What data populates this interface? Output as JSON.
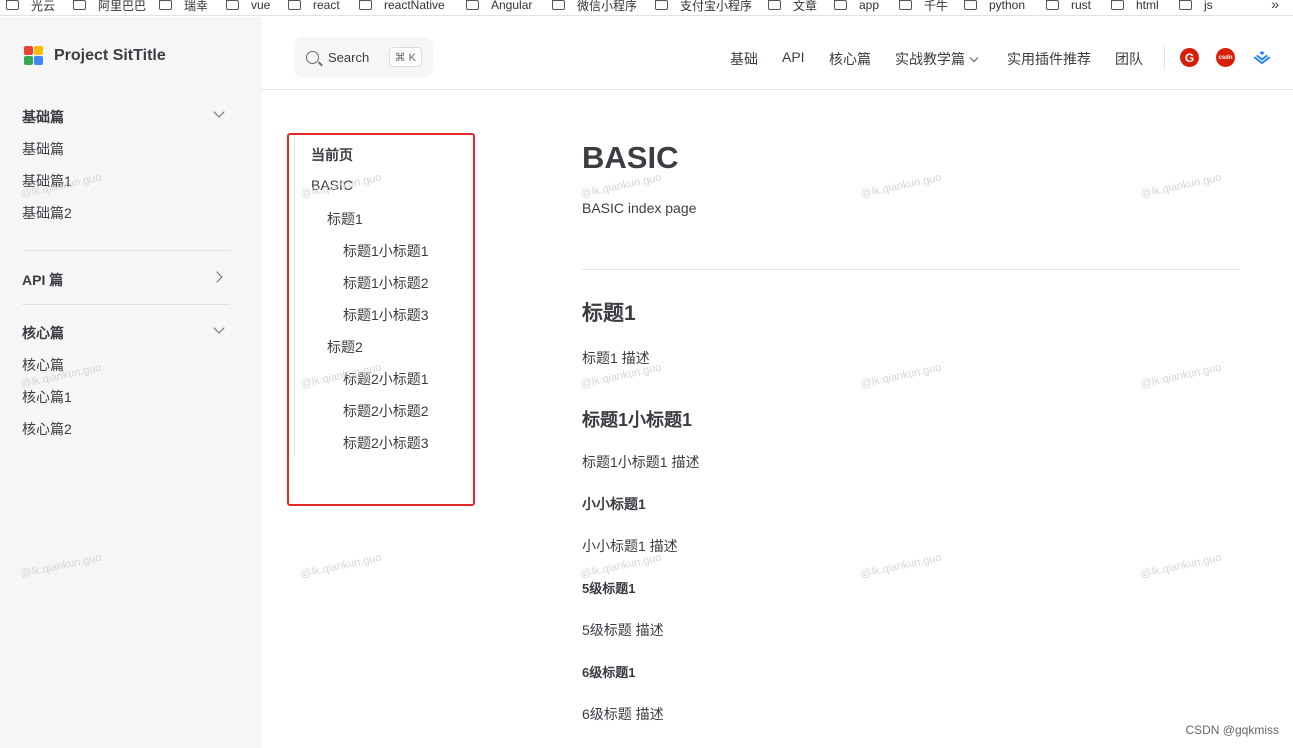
{
  "bookmarks": {
    "items": [
      "光云",
      "阿里巴巴",
      "瑞幸",
      "vue",
      "react",
      "reactNative",
      "Angular",
      "微信小程序",
      "支付宝小程序",
      "文章",
      "app",
      "千牛",
      "python",
      "rust",
      "html",
      "js"
    ],
    "more": "»"
  },
  "sidebar": {
    "logo_text": "Project SitTitle",
    "groups": [
      {
        "title": "基础篇",
        "expanded": true,
        "items": [
          "基础篇",
          "基础篇1",
          "基础篇2"
        ]
      },
      {
        "title": "API 篇",
        "expanded": false,
        "items": []
      },
      {
        "title": "核心篇",
        "expanded": true,
        "items": [
          "核心篇",
          "核心篇1",
          "核心篇2"
        ]
      }
    ]
  },
  "topnav": {
    "search_label": "Search",
    "search_shortcut": "⌘ K",
    "items": [
      "基础",
      "API",
      "核心篇",
      "实战教学篇",
      "实用插件推荐",
      "团队"
    ],
    "social": {
      "g": "G",
      "csdn": "csdn"
    }
  },
  "outline": {
    "title": "当前页",
    "items": [
      {
        "label": "BASIC",
        "level": 1
      },
      {
        "label": "标题1",
        "level": 2
      },
      {
        "label": "标题1小标题1",
        "level": 3
      },
      {
        "label": "标题1小标题2",
        "level": 3
      },
      {
        "label": "标题1小标题3",
        "level": 3
      },
      {
        "label": "标题2",
        "level": 2
      },
      {
        "label": "标题2小标题1",
        "level": 3
      },
      {
        "label": "标题2小标题2",
        "level": 3
      },
      {
        "label": "标题2小标题3",
        "level": 3
      }
    ]
  },
  "content": {
    "title": "BASIC",
    "intro": "BASIC index page",
    "h2": "标题1",
    "h2_desc": "标题1 描述",
    "h3": "标题1小标题1",
    "h3_desc": "标题1小标题1 描述",
    "h4": "小小标题1",
    "h4_desc": "小小标题1 描述",
    "h5": "5级标题1",
    "h5_desc": "5级标题 描述",
    "h6": "6级标题1",
    "h6_desc": "6级标题 描述"
  },
  "watermark": "@lk.qiankun.guo",
  "credit": "CSDN @gqkmiss"
}
